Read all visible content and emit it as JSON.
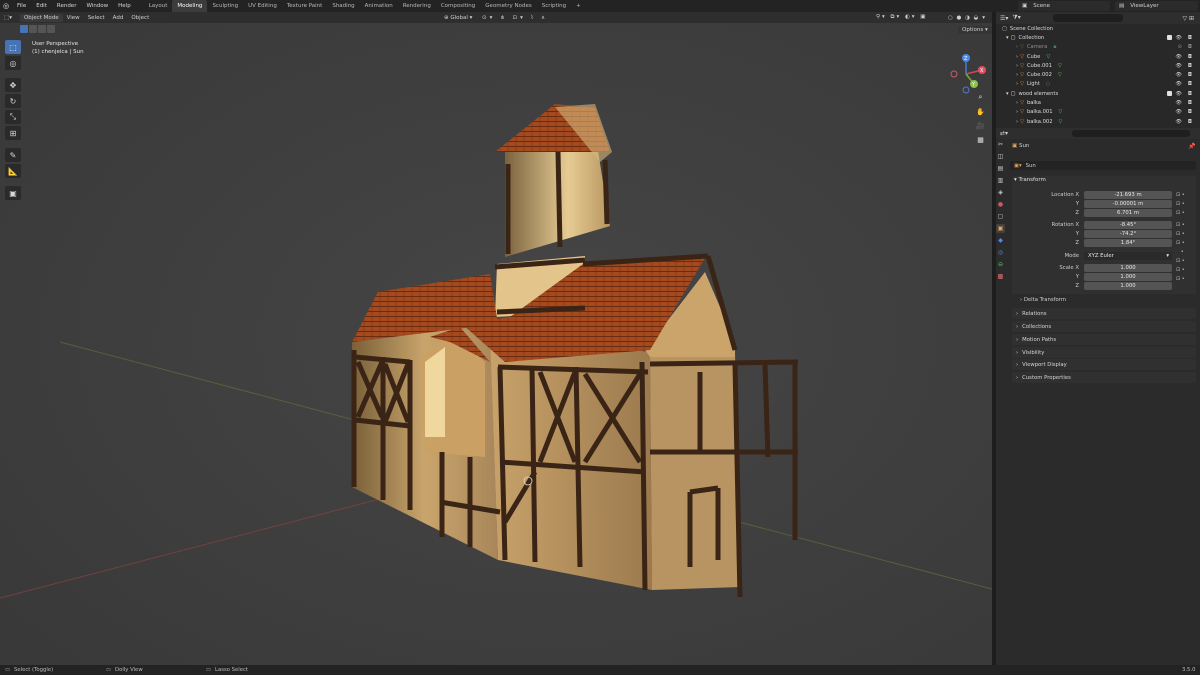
{
  "topbar": {
    "menu": [
      "File",
      "Edit",
      "Render",
      "Window",
      "Help"
    ],
    "tabs": [
      "Layout",
      "Modeling",
      "Sculpting",
      "UV Editing",
      "Texture Paint",
      "Shading",
      "Animation",
      "Rendering",
      "Compositing",
      "Geometry Nodes",
      "Scripting",
      "+"
    ],
    "active_tab": "Modeling",
    "scene": "Scene",
    "view_layer": "ViewLayer"
  },
  "viewport": {
    "mode": "Object Mode",
    "menu": [
      "View",
      "Select",
      "Add",
      "Object"
    ],
    "transform_orientation": "Global",
    "options_label": "Options",
    "info_line1": "User Perspective",
    "info_line2": "(1) chenjeica | Sun",
    "gizmo_axes": [
      "X",
      "Y",
      "Z"
    ]
  },
  "outliner": {
    "root": "Scene Collection",
    "rows": [
      {
        "label": "Collection",
        "indent": 0,
        "kind": "collection"
      },
      {
        "label": "Camera",
        "indent": 1,
        "kind": "camera"
      },
      {
        "label": "Cube",
        "indent": 1,
        "kind": "mesh"
      },
      {
        "label": "Cube.001",
        "indent": 1,
        "kind": "mesh"
      },
      {
        "label": "Cube.002",
        "indent": 1,
        "kind": "mesh"
      },
      {
        "label": "Light",
        "indent": 1,
        "kind": "light"
      },
      {
        "label": "wood elements",
        "indent": 0,
        "kind": "collection"
      },
      {
        "label": "balka",
        "indent": 1,
        "kind": "mesh"
      },
      {
        "label": "balka.001",
        "indent": 1,
        "kind": "mesh"
      },
      {
        "label": "balka.002",
        "indent": 1,
        "kind": "mesh"
      }
    ]
  },
  "properties": {
    "object_name": "Sun",
    "datablock_name": "Sun",
    "transform_label": "Transform",
    "location_label": "Location X",
    "location": [
      "-21.693 m",
      "-0.00001 m",
      "6.701 m"
    ],
    "rotation_label": "Rotation X",
    "rotation": [
      "-8.45°",
      "-74.2°",
      "1.84°"
    ],
    "mode_label": "Mode",
    "mode": "XYZ Euler",
    "scale_label": "Scale X",
    "scale": [
      "1.000",
      "1.000",
      "1.000"
    ],
    "axis_y": "Y",
    "axis_z": "Z",
    "delta_transform": "Delta Transform",
    "sections": [
      "Relations",
      "Collections",
      "Motion Paths",
      "Visibility",
      "Viewport Display",
      "Custom Properties"
    ]
  },
  "statusbar": {
    "left": "Select (Toggle)",
    "mid": "Dolly View",
    "right": "Lasso Select",
    "version": "3.5.0"
  }
}
